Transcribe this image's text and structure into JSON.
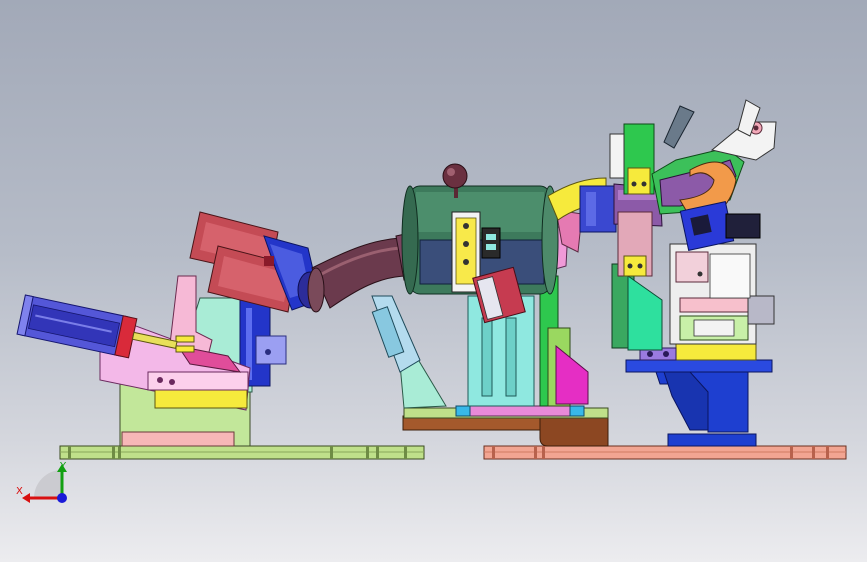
{
  "viewport": {
    "background_top": "#a2a9b8",
    "background_bottom": "#ececef"
  },
  "triad": {
    "x_label": "X",
    "y_label": "Y",
    "x_color": "#d81010",
    "y_color": "#12a012",
    "z_color": "#1a1ad8"
  },
  "model": {
    "left_baseplate_color": "#bfe08a",
    "right_baseplate_color": "#f2a592",
    "pipe_color": "#6b3a4d",
    "canister_color": "#3d7a5c",
    "right_stand_color": "#1e3fd0"
  }
}
